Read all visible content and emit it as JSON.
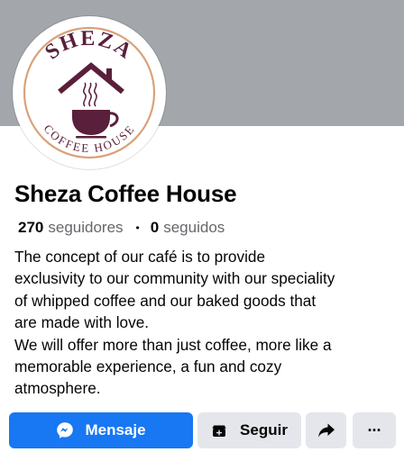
{
  "profile": {
    "logo": {
      "top_text": "SHEZA",
      "bottom_text": "COFFEE HOUSE",
      "colors": {
        "ring": "#d9a27a",
        "text": "#5a1f3a",
        "cup": "#5a1f3a",
        "house": "#5a1f3a"
      }
    },
    "name": "Sheza Coffee House",
    "followers": {
      "count": "270",
      "label": "seguidores"
    },
    "following": {
      "count": "0",
      "label": "seguidos"
    },
    "separator": "•",
    "bio": [
      "The concept of our café is to provide",
      "exclusivity to our community with our speciality",
      "of whipped coffee and our baked goods that",
      "are made with love.",
      "We will offer more than just coffee, more like a",
      "memorable experience, a fun and cozy",
      "atmosphere."
    ]
  },
  "actions": {
    "message": {
      "label": "Mensaje",
      "icon": "messenger-icon"
    },
    "follow": {
      "label": "Seguir",
      "icon": "follow-icon"
    },
    "share": {
      "icon": "share-arrow-icon"
    },
    "more": {
      "label": "···",
      "icon": "more-dots-icon"
    }
  },
  "colors": {
    "cover": "#a3a6ab",
    "primary": "#1877f2",
    "secondary_button": "#e4e6eb",
    "text": "#050505",
    "muted_text": "#65676b"
  }
}
